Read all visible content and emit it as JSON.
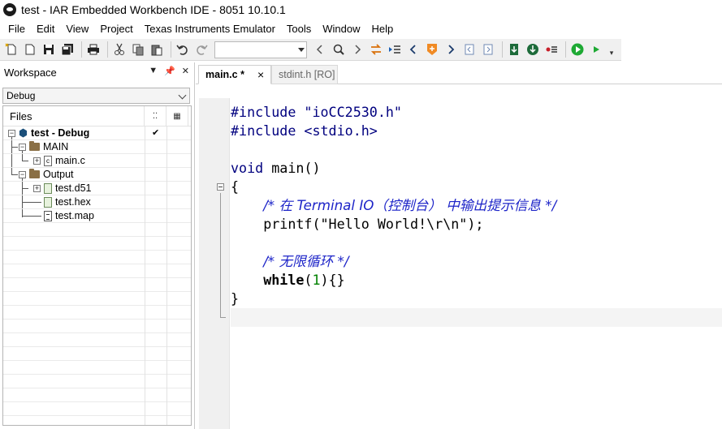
{
  "window": {
    "title": "test - IAR Embedded Workbench IDE - 8051 10.10.1"
  },
  "menu": [
    "File",
    "Edit",
    "View",
    "Project",
    "Texas Instruments Emulator",
    "Tools",
    "Window",
    "Help"
  ],
  "toolbar": {
    "search_combo_value": "",
    "icons": [
      "new-file-icon",
      "open-folder-icon",
      "save-icon",
      "save-all-icon",
      "print-icon",
      "cut-icon",
      "copy-icon",
      "paste-icon",
      "undo-icon",
      "redo-icon",
      "nav-back-icon",
      "find-icon",
      "nav-forward-icon",
      "replace-icon",
      "go-to-icon",
      "prev-bookmark-icon",
      "bookmark-icon",
      "next-bookmark-icon",
      "prev-marker-icon",
      "next-marker-icon",
      "download-icon",
      "download-debug-icon",
      "breakpoint-icon",
      "debug-icon",
      "run-icon"
    ]
  },
  "workspace": {
    "title": "Workspace",
    "configuration": "Debug",
    "files_header": "Files",
    "tree": [
      {
        "label": "test - Debug",
        "level": 0,
        "type": "project",
        "checked": true
      },
      {
        "label": "MAIN",
        "level": 1,
        "type": "folder"
      },
      {
        "label": "main.c",
        "level": 2,
        "type": "c-file"
      },
      {
        "label": "Output",
        "level": 1,
        "type": "folder"
      },
      {
        "label": "test.d51",
        "level": 2,
        "type": "output-file"
      },
      {
        "label": "test.hex",
        "level": 2,
        "type": "output-file"
      },
      {
        "label": "test.map",
        "level": 2,
        "type": "map-file"
      }
    ]
  },
  "tabs": [
    {
      "label": "main.c *",
      "active": true,
      "closable": true
    },
    {
      "label": "stdint.h [RO]",
      "active": false,
      "closable": false
    }
  ],
  "code": {
    "line1_directive": "#include",
    "line1_header": "\"ioCC2530.h\"",
    "line2_directive": "#include",
    "line2_header": "<stdio.h>",
    "line4_type": "void",
    "line4_rest": " main()",
    "line5": "{",
    "line6_comment": "/* 在 Terminal IO（控制台） 中输出提示信息 */",
    "line7": "printf(\"Hello World!\\r\\n\");",
    "line9_comment": "/* 无限循环 */",
    "line10_kw": "while",
    "line10_paren_open": "(",
    "line10_num": "1",
    "line10_rest": "){}",
    "line11": "}"
  }
}
